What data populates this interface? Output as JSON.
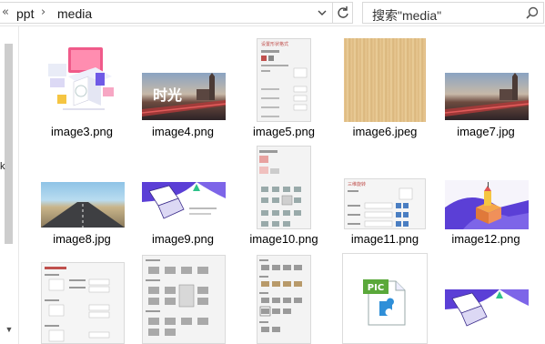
{
  "address": {
    "chevron": "«",
    "crumbs": [
      "ppt",
      "media"
    ],
    "separator": "›"
  },
  "search": {
    "placeholder": "搜索\"media\""
  },
  "sidebar": {
    "partial_label": "k"
  },
  "files": [
    {
      "name": "image3.png"
    },
    {
      "name": "image4.png"
    },
    {
      "name": "image5.png"
    },
    {
      "name": "image6.jpeg"
    },
    {
      "name": "image7.jpg"
    },
    {
      "name": "image8.jpg"
    },
    {
      "name": "image9.png"
    },
    {
      "name": "image10.png"
    },
    {
      "name": "image11.png"
    },
    {
      "name": "image12.png"
    }
  ],
  "thumb_text": {
    "pic_badge": "PIC",
    "time_logo": "时光",
    "dialog_title": "设置形状格式",
    "three_d": "三维旋转"
  },
  "colors": {
    "accent_purple": "#5b3fd6",
    "folder_text": "#000000"
  }
}
